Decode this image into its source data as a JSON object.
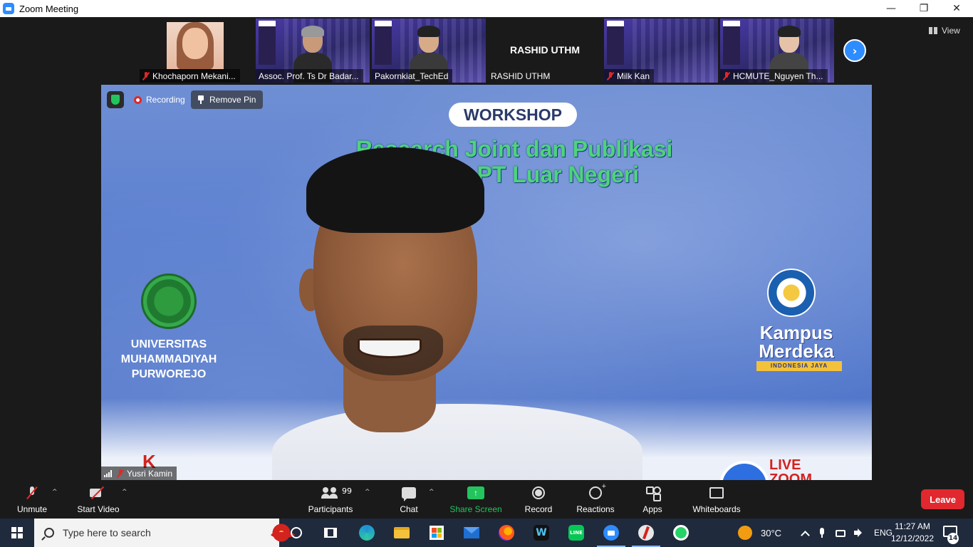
{
  "window": {
    "title": "Zoom Meeting",
    "minimize": "—",
    "restore": "❐",
    "close": "✕"
  },
  "gallery": {
    "participants": [
      {
        "name": "Khochaporn Mekani...",
        "muted": true
      },
      {
        "name": "Assoc. Prof. Ts Dr Badar...",
        "muted": false
      },
      {
        "name": "Pakornkiat_TechEd",
        "muted": false
      },
      {
        "name": "RASHID UTHM",
        "center_label": "RASHID UTHM",
        "muted": false
      },
      {
        "name": "Milk Kan",
        "muted": true
      },
      {
        "name": "HCMUTE_Nguyen Th...",
        "muted": true
      }
    ],
    "next_label": "›",
    "view_label": "View"
  },
  "main_video": {
    "recording_label": "Recording",
    "remove_pin_label": "Remove Pin",
    "speaker_name": "Yusri Kamin",
    "slide": {
      "workshop": "WORKSHOP",
      "title_line1": "Research Joint dan Publikasi",
      "title_line2": "dengan PT Luar Negeri",
      "university_line1": "UNIVERSITAS",
      "university_line2": "MUHAMMADIYAH",
      "university_line3": "PURWOREJO",
      "kampus_line1": "Kampus",
      "kampus_line2": "Merdeka",
      "kampus_tag": "INDONESIA JAYA",
      "live_line1": "LIVE",
      "live_line2": "ZOOM",
      "red_letter": "K"
    }
  },
  "toolbar": {
    "unmute": "Unmute",
    "start_video": "Start Video",
    "participants": "Participants",
    "participant_count": "99",
    "chat": "Chat",
    "share_screen": "Share Screen",
    "share_arrow": "↑",
    "record": "Record",
    "reactions": "Reactions",
    "apps": "Apps",
    "whiteboards": "Whiteboards",
    "leave": "Leave",
    "caret": "^"
  },
  "taskbar": {
    "search_placeholder": "Type here to search",
    "webex_glyph": "W",
    "line_glyph": "LINE",
    "temperature": "30°C",
    "language": "ENG",
    "time": "11:27 AM",
    "date": "12/12/2022",
    "notification_count": "14"
  },
  "colors": {
    "zoom_blue": "#2d8cff",
    "leave_red": "#e0282e",
    "share_green": "#23c45e",
    "slide_green": "#4fd37a"
  }
}
